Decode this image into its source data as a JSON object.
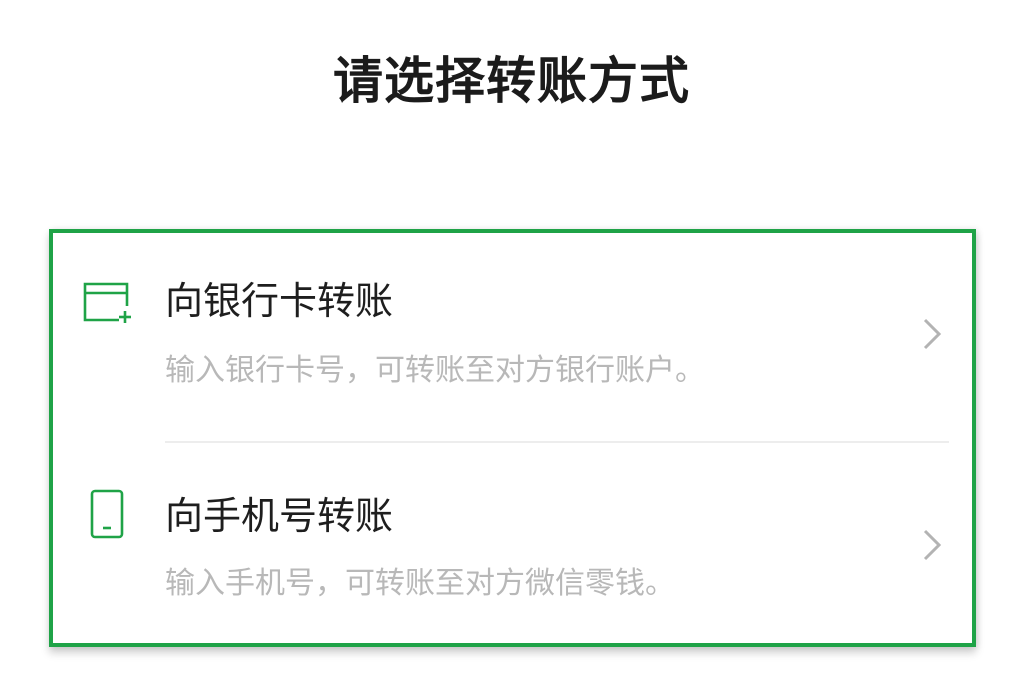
{
  "page": {
    "title": "请选择转账方式"
  },
  "options": [
    {
      "icon": "bank-card-add-icon",
      "title": "向银行卡转账",
      "description": "输入银行卡号，可转账至对方银行账户。"
    },
    {
      "icon": "mobile-phone-icon",
      "title": "向手机号转账",
      "description": "输入手机号，可转账至对方微信零钱。"
    }
  ],
  "colors": {
    "accent": "#1fa347",
    "title_text": "#1b1b1b",
    "secondary_text": "#b8b8b8",
    "chevron": "#b3b3b3",
    "divider": "#ededed"
  }
}
